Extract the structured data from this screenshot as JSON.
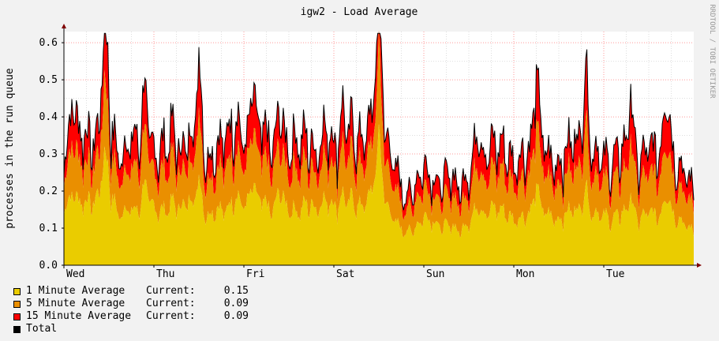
{
  "chart_data": {
    "type": "area",
    "title": "igw2 - Load Average",
    "ylabel": "processes in the run queue",
    "watermark": "RRDTOOL / TOBI OETIKER",
    "ylim": [
      0,
      0.63
    ],
    "yticks": [
      "0.0",
      "0.1",
      "0.2",
      "0.3",
      "0.4",
      "0.5",
      "0.6"
    ],
    "ytick_values": [
      0,
      0.1,
      0.2,
      0.3,
      0.4,
      0.5,
      0.6
    ],
    "xlim": [
      0,
      7
    ],
    "categories": [
      "Wed",
      "Thu",
      "Fri",
      "Sat",
      "Sun",
      "Mon",
      "Tue"
    ],
    "stacked": true,
    "colors": {
      "canvas": "#ffffff",
      "background": "#f2f2f2",
      "grid_major": "#ff9999",
      "grid_minor": "#dddddd",
      "one": "#eacc00",
      "five": "#ea8f00",
      "fifteen": "#ff0000",
      "total": "#000000"
    },
    "series": [
      {
        "name": "1 Minute Average",
        "color": "#eacc00",
        "current": "0.15",
        "points": [
          [
            0.0,
            0.15
          ],
          [
            0.1,
            0.14
          ],
          [
            0.2,
            0.16
          ],
          [
            0.3,
            0.15
          ],
          [
            0.4,
            0.17
          ],
          [
            0.5,
            0.2
          ],
          [
            0.6,
            0.12
          ],
          [
            0.7,
            0.14
          ],
          [
            0.8,
            0.13
          ],
          [
            0.9,
            0.16
          ],
          [
            1.0,
            0.14
          ],
          [
            1.1,
            0.13
          ],
          [
            1.2,
            0.15
          ],
          [
            1.3,
            0.14
          ],
          [
            1.4,
            0.16
          ],
          [
            1.5,
            0.15
          ],
          [
            1.6,
            0.12
          ],
          [
            1.7,
            0.14
          ],
          [
            1.8,
            0.13
          ],
          [
            1.9,
            0.17
          ],
          [
            2.0,
            0.15
          ],
          [
            2.1,
            0.14
          ],
          [
            2.2,
            0.16
          ],
          [
            2.3,
            0.13
          ],
          [
            2.4,
            0.15
          ],
          [
            2.5,
            0.14
          ],
          [
            2.6,
            0.13
          ],
          [
            2.7,
            0.15
          ],
          [
            2.8,
            0.14
          ],
          [
            2.9,
            0.16
          ],
          [
            3.0,
            0.15
          ],
          [
            3.1,
            0.13
          ],
          [
            3.2,
            0.16
          ],
          [
            3.3,
            0.14
          ],
          [
            3.4,
            0.17
          ],
          [
            3.5,
            0.22
          ],
          [
            3.6,
            0.14
          ],
          [
            3.7,
            0.1
          ],
          [
            3.8,
            0.08
          ],
          [
            3.9,
            0.09
          ],
          [
            4.0,
            0.12
          ],
          [
            4.1,
            0.11
          ],
          [
            4.2,
            0.09
          ],
          [
            4.3,
            0.1
          ],
          [
            4.4,
            0.08
          ],
          [
            4.5,
            0.11
          ],
          [
            4.6,
            0.12
          ],
          [
            4.7,
            0.13
          ],
          [
            4.8,
            0.14
          ],
          [
            4.9,
            0.13
          ],
          [
            5.0,
            0.11
          ],
          [
            5.1,
            0.12
          ],
          [
            5.2,
            0.13
          ],
          [
            5.3,
            0.14
          ],
          [
            5.4,
            0.12
          ],
          [
            5.5,
            0.11
          ],
          [
            5.6,
            0.13
          ],
          [
            5.7,
            0.14
          ],
          [
            5.8,
            0.12
          ],
          [
            5.9,
            0.13
          ],
          [
            6.0,
            0.12
          ],
          [
            6.1,
            0.11
          ],
          [
            6.2,
            0.13
          ],
          [
            6.3,
            0.12
          ],
          [
            6.4,
            0.11
          ],
          [
            6.5,
            0.13
          ],
          [
            6.6,
            0.12
          ],
          [
            6.7,
            0.14
          ],
          [
            6.8,
            0.12
          ],
          [
            6.9,
            0.1
          ],
          [
            7.0,
            0.08
          ]
        ]
      },
      {
        "name": "5 Minute Average",
        "color": "#ea8f00",
        "current": "0.09",
        "points": [
          [
            0.0,
            0.08
          ],
          [
            0.1,
            0.09
          ],
          [
            0.2,
            0.1
          ],
          [
            0.3,
            0.08
          ],
          [
            0.4,
            0.09
          ],
          [
            0.5,
            0.1
          ],
          [
            0.6,
            0.08
          ],
          [
            0.7,
            0.09
          ],
          [
            0.8,
            0.1
          ],
          [
            0.9,
            0.09
          ],
          [
            1.0,
            0.08
          ],
          [
            1.1,
            0.09
          ],
          [
            1.2,
            0.1
          ],
          [
            1.3,
            0.08
          ],
          [
            1.4,
            0.09
          ],
          [
            1.5,
            0.1
          ],
          [
            1.6,
            0.08
          ],
          [
            1.7,
            0.09
          ],
          [
            1.8,
            0.1
          ],
          [
            1.9,
            0.11
          ],
          [
            2.0,
            0.09
          ],
          [
            2.1,
            0.08
          ],
          [
            2.2,
            0.1
          ],
          [
            2.3,
            0.09
          ],
          [
            2.4,
            0.08
          ],
          [
            2.5,
            0.09
          ],
          [
            2.6,
            0.1
          ],
          [
            2.7,
            0.09
          ],
          [
            2.8,
            0.08
          ],
          [
            2.9,
            0.1
          ],
          [
            3.0,
            0.09
          ],
          [
            3.1,
            0.08
          ],
          [
            3.2,
            0.1
          ],
          [
            3.3,
            0.09
          ],
          [
            3.4,
            0.1
          ],
          [
            3.5,
            0.12
          ],
          [
            3.6,
            0.09
          ],
          [
            3.7,
            0.07
          ],
          [
            3.8,
            0.05
          ],
          [
            3.9,
            0.06
          ],
          [
            4.0,
            0.07
          ],
          [
            4.1,
            0.06
          ],
          [
            4.2,
            0.06
          ],
          [
            4.3,
            0.07
          ],
          [
            4.4,
            0.06
          ],
          [
            4.5,
            0.07
          ],
          [
            4.6,
            0.08
          ],
          [
            4.7,
            0.08
          ],
          [
            4.8,
            0.09
          ],
          [
            4.9,
            0.09
          ],
          [
            5.0,
            0.08
          ],
          [
            5.1,
            0.09
          ],
          [
            5.2,
            0.09
          ],
          [
            5.3,
            0.1
          ],
          [
            5.4,
            0.08
          ],
          [
            5.5,
            0.08
          ],
          [
            5.6,
            0.09
          ],
          [
            5.7,
            0.1
          ],
          [
            5.8,
            0.09
          ],
          [
            5.9,
            0.09
          ],
          [
            6.0,
            0.08
          ],
          [
            6.1,
            0.08
          ],
          [
            6.2,
            0.09
          ],
          [
            6.3,
            0.09
          ],
          [
            6.4,
            0.08
          ],
          [
            6.5,
            0.09
          ],
          [
            6.6,
            0.09
          ],
          [
            6.7,
            0.1
          ],
          [
            6.8,
            0.08
          ],
          [
            6.9,
            0.07
          ],
          [
            7.0,
            0.06
          ]
        ]
      },
      {
        "name": "15 Minute Average",
        "color": "#ff0000",
        "current": "0.09",
        "points": [
          [
            0.0,
            0.05
          ],
          [
            0.1,
            0.06
          ],
          [
            0.2,
            0.07
          ],
          [
            0.3,
            0.06
          ],
          [
            0.4,
            0.06
          ],
          [
            0.5,
            0.08
          ],
          [
            0.6,
            0.05
          ],
          [
            0.7,
            0.06
          ],
          [
            0.8,
            0.07
          ],
          [
            0.9,
            0.06
          ],
          [
            1.0,
            0.05
          ],
          [
            1.1,
            0.06
          ],
          [
            1.2,
            0.07
          ],
          [
            1.3,
            0.05
          ],
          [
            1.4,
            0.06
          ],
          [
            1.5,
            0.07
          ],
          [
            1.6,
            0.05
          ],
          [
            1.7,
            0.06
          ],
          [
            1.8,
            0.07
          ],
          [
            1.9,
            0.08
          ],
          [
            2.0,
            0.06
          ],
          [
            2.1,
            0.05
          ],
          [
            2.2,
            0.07
          ],
          [
            2.3,
            0.06
          ],
          [
            2.4,
            0.05
          ],
          [
            2.5,
            0.06
          ],
          [
            2.6,
            0.07
          ],
          [
            2.7,
            0.06
          ],
          [
            2.8,
            0.05
          ],
          [
            2.9,
            0.07
          ],
          [
            3.0,
            0.06
          ],
          [
            3.1,
            0.05
          ],
          [
            3.2,
            0.07
          ],
          [
            3.3,
            0.06
          ],
          [
            3.4,
            0.07
          ],
          [
            3.5,
            0.08
          ],
          [
            3.6,
            0.06
          ],
          [
            3.7,
            0.05
          ],
          [
            3.8,
            0.03
          ],
          [
            3.9,
            0.04
          ],
          [
            4.0,
            0.05
          ],
          [
            4.1,
            0.04
          ],
          [
            4.2,
            0.04
          ],
          [
            4.3,
            0.05
          ],
          [
            4.4,
            0.04
          ],
          [
            4.5,
            0.05
          ],
          [
            4.6,
            0.05
          ],
          [
            4.7,
            0.06
          ],
          [
            4.8,
            0.06
          ],
          [
            4.9,
            0.06
          ],
          [
            5.0,
            0.05
          ],
          [
            5.1,
            0.06
          ],
          [
            5.2,
            0.06
          ],
          [
            5.3,
            0.07
          ],
          [
            5.4,
            0.05
          ],
          [
            5.5,
            0.05
          ],
          [
            5.6,
            0.06
          ],
          [
            5.7,
            0.07
          ],
          [
            5.8,
            0.06
          ],
          [
            5.9,
            0.06
          ],
          [
            6.0,
            0.05
          ],
          [
            6.1,
            0.05
          ],
          [
            6.2,
            0.06
          ],
          [
            6.3,
            0.06
          ],
          [
            6.4,
            0.05
          ],
          [
            6.5,
            0.06
          ],
          [
            6.6,
            0.06
          ],
          [
            6.7,
            0.07
          ],
          [
            6.8,
            0.05
          ],
          [
            6.9,
            0.05
          ],
          [
            7.0,
            0.04
          ]
        ]
      },
      {
        "name": "Total",
        "color": "#000000",
        "current": "",
        "peaks": [
          [
            0.1,
            0.43
          ],
          [
            0.45,
            0.6
          ],
          [
            0.9,
            0.44
          ],
          [
            1.5,
            0.5
          ],
          [
            2.1,
            0.49
          ],
          [
            2.4,
            0.42
          ],
          [
            3.1,
            0.44
          ],
          [
            3.5,
            0.62
          ],
          [
            3.9,
            0.27
          ],
          [
            4.6,
            0.41
          ],
          [
            5.25,
            0.49
          ],
          [
            5.8,
            0.54
          ],
          [
            6.3,
            0.46
          ],
          [
            6.7,
            0.45
          ]
        ]
      }
    ]
  }
}
